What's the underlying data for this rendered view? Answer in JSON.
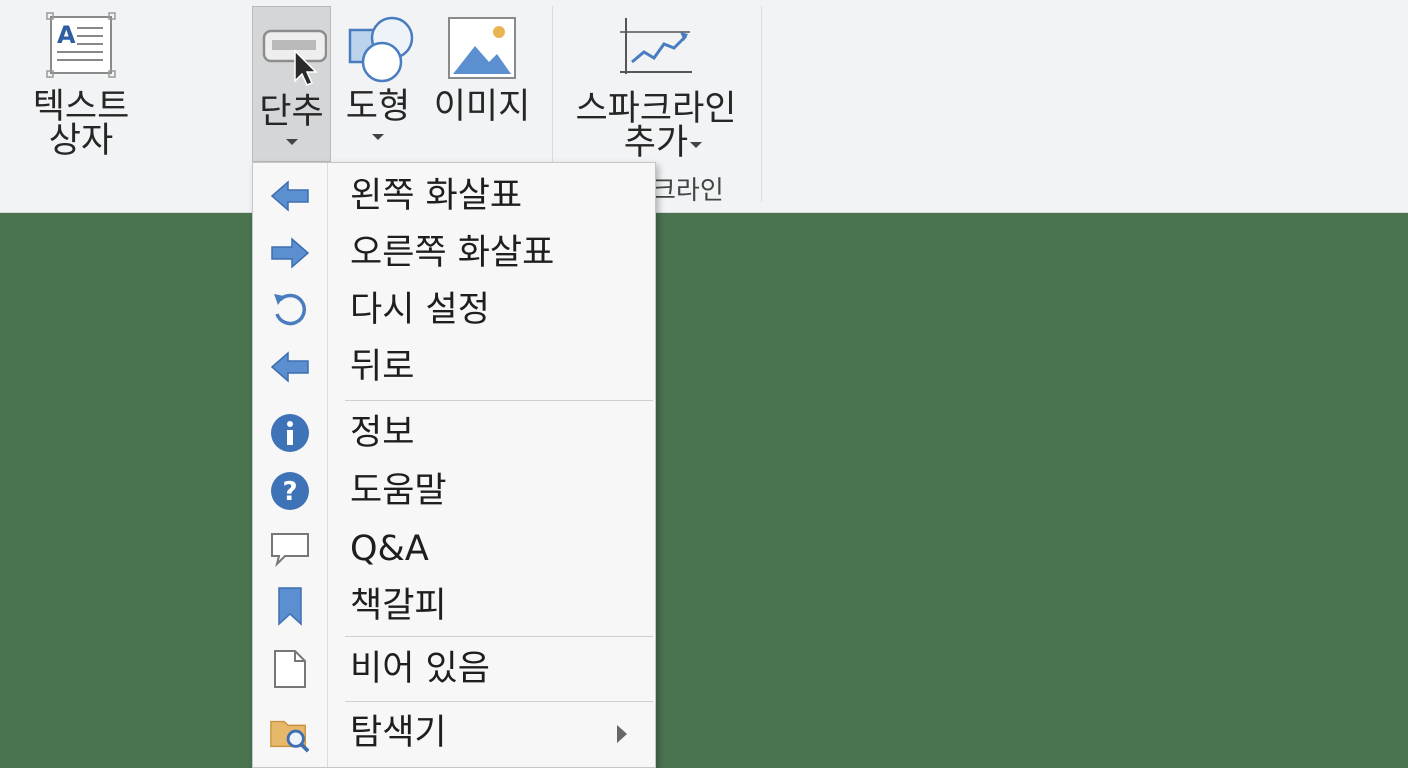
{
  "ribbon": {
    "textbox_label": "텍스트\n상자",
    "shortcut_label": "단추",
    "shapes_label": "도형",
    "image_label": "이미지",
    "sparkline_label": "스파크라인\n추가",
    "group_sparkline_label": "크라인"
  },
  "menu": {
    "items": [
      {
        "label": "왼쪽 화살표",
        "icon": "left-arrow-icon"
      },
      {
        "label": "오른쪽 화살표",
        "icon": "right-arrow-icon"
      },
      {
        "label": "다시 설정",
        "icon": "reset-icon"
      },
      {
        "label": "뒤로",
        "icon": "back-arrow-icon"
      },
      {
        "label": "정보",
        "icon": "info-icon"
      },
      {
        "label": "도움말",
        "icon": "help-icon"
      },
      {
        "label": "Q&A",
        "icon": "speech-bubble-icon"
      },
      {
        "label": "책갈피",
        "icon": "bookmark-icon"
      },
      {
        "label": "비어 있음",
        "icon": "blank-page-icon"
      },
      {
        "label": "탐색기",
        "icon": "folder-search-icon"
      }
    ]
  },
  "colors": {
    "accent_blue": "#4a7cc0",
    "ribbon_bg": "#f1f3f4",
    "workspace_bg": "#4a7350"
  }
}
